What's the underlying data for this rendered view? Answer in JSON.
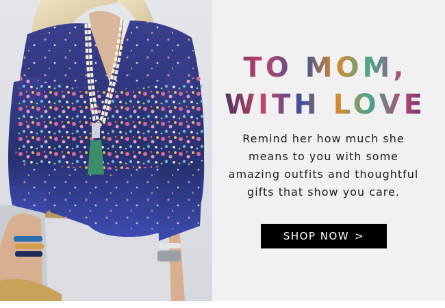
{
  "headline": {
    "line1": "TO MOM,",
    "line2": "WITH LOVE"
  },
  "body_text": "Remind her how much she means to you with some amazing outfits and thoughtful gifts that show you care.",
  "cta": {
    "label": "SHOP NOW",
    "icon": "chevron-right-icon",
    "glyph": ">"
  },
  "colors": {
    "banner_background": "#f1f1f1",
    "blouse": "#2c3a8a",
    "cta_background": "#000000",
    "cta_text": "#ffffff"
  }
}
